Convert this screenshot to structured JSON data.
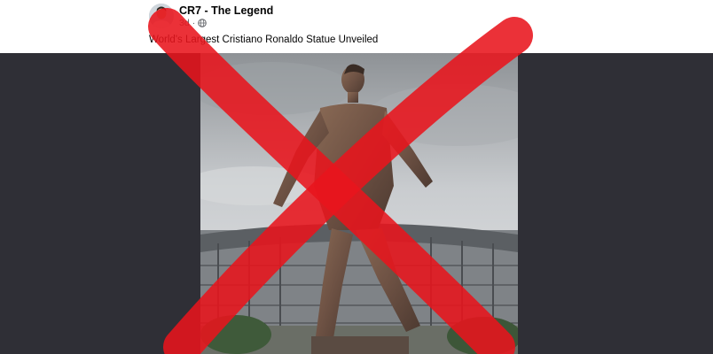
{
  "post": {
    "page_name": "CR7 - The Legend",
    "time": "3d",
    "audience_icon": "globe-icon",
    "caption": "World's Largest Cristiano Ronaldo Statue Unveiled"
  },
  "image": {
    "subject": "statue-photo",
    "overlay": "red-x-mark"
  },
  "colors": {
    "viewer_background": "#2f2f36",
    "x_mark": "#e8141c",
    "name_text": "#050505",
    "meta_text": "#65676b"
  }
}
